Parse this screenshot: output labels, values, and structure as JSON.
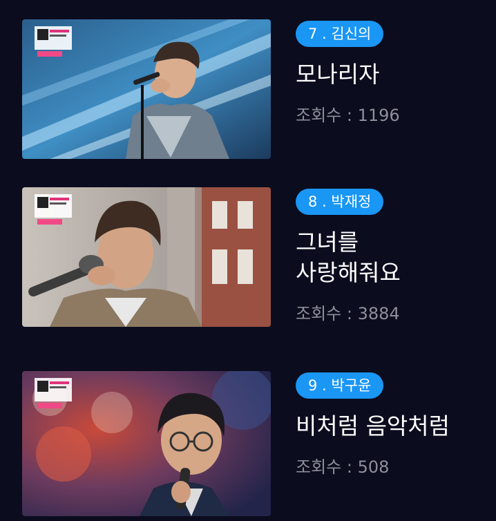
{
  "items": [
    {
      "rank_label": "7 . 김신의",
      "title_lines": [
        "모나리자"
      ],
      "views": "조회수 : 1196",
      "thumbnail": "singer-performance-blue-stage"
    },
    {
      "rank_label": "8 . 박재정",
      "title_lines": [
        "그녀를",
        "사랑해줘요"
      ],
      "views": "조회수 : 3884",
      "thumbnail": "singer-performance-brick-building"
    },
    {
      "rank_label": "9 . 박구윤",
      "title_lines": [
        "비처럼 음악처럼"
      ],
      "views": "조회수 : 508",
      "thumbnail": "singer-performance-floral-backdrop"
    }
  ],
  "colors": {
    "background": "#0b0c1e",
    "badge": "#1a96f5",
    "title": "#ffffff",
    "views": "#8e8f99"
  }
}
